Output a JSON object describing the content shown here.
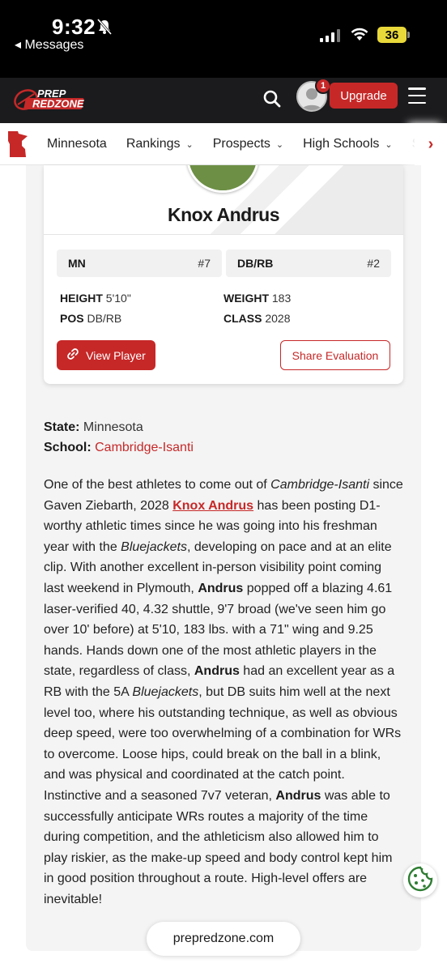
{
  "status_bar": {
    "time": "9:32",
    "back_label": "◂ Messages",
    "battery": "36"
  },
  "header": {
    "logo_line1": "PREP",
    "logo_line2": "REDZONE",
    "notification_count": "1",
    "upgrade_label": "Upgrade"
  },
  "subnav": {
    "items": [
      {
        "label": "Minnesota",
        "has_dropdown": false
      },
      {
        "label": "Rankings",
        "has_dropdown": true
      },
      {
        "label": "Prospects",
        "has_dropdown": true
      },
      {
        "label": "High Schools",
        "has_dropdown": true
      },
      {
        "label": "S",
        "has_dropdown": false
      }
    ]
  },
  "player_card": {
    "name": "Knox Andrus",
    "state_rank_label": "MN",
    "state_rank_value": "#7",
    "pos_rank_label": "DB/RB",
    "pos_rank_value": "#2",
    "height_label": "HEIGHT",
    "height_value": "5'10\"",
    "weight_label": "WEIGHT",
    "weight_value": "183",
    "pos_label": "POS",
    "pos_value": "DB/RB",
    "class_label": "CLASS",
    "class_value": "2028",
    "view_label": "View Player",
    "share_label": "Share Evaluation"
  },
  "article": {
    "state_label": "State:",
    "state_value": "Minnesota",
    "school_label": "School:",
    "school_value": "Cambridge-Isanti",
    "p1": "One of the best athletes to come out of ",
    "p1_i": "Cambridge-Isanti",
    "p2": " since Gaven Ziebarth, 2028 ",
    "p2_link": "Knox Andrus",
    "p3": " has been posting D1-worthy athletic times since he was going into his freshman year with the ",
    "p3_i": "Bluejackets",
    "p4": ", developing on pace and at an elite clip. With another excellent in-person visibility point coming last weekend in Plymouth, ",
    "p4_b": "Andrus",
    "p5": " popped off a blazing 4.61 laser-verified 40, 4.32 shuttle, 9'7 broad (we've seen him go over 10' before) at 5'10, 183 lbs. with a 71\" wing and 9.25 hands. Hands down one of the most athletic players in the state, regardless of class, ",
    "p5_b": "Andrus",
    "p6": " had an excellent year as a RB with the 5A ",
    "p6_i": "Bluejackets",
    "p7": ", but DB suits him well at the next level too, where his outstanding technique, as well as obvious deep speed, were too overwhelming of a combination for WRs to overcome. Loose hips, could break on the ball in a blink, and was physical and coordinated at the catch point. Instinctive and a seasoned 7v7 veteran, ",
    "p7_b": "Andrus",
    "p8": " was able to successfully anticipate WRs routes a majority of the time during competition, and the athleticism also allowed him to play riskier, as the make-up speed and body control kept him in good position throughout a route. High-level offers are inevitable!"
  },
  "url_bar": {
    "domain": "prepredzone.com"
  },
  "colors": {
    "brand_red": "#c62828",
    "header_bg": "#1b1b1d"
  }
}
